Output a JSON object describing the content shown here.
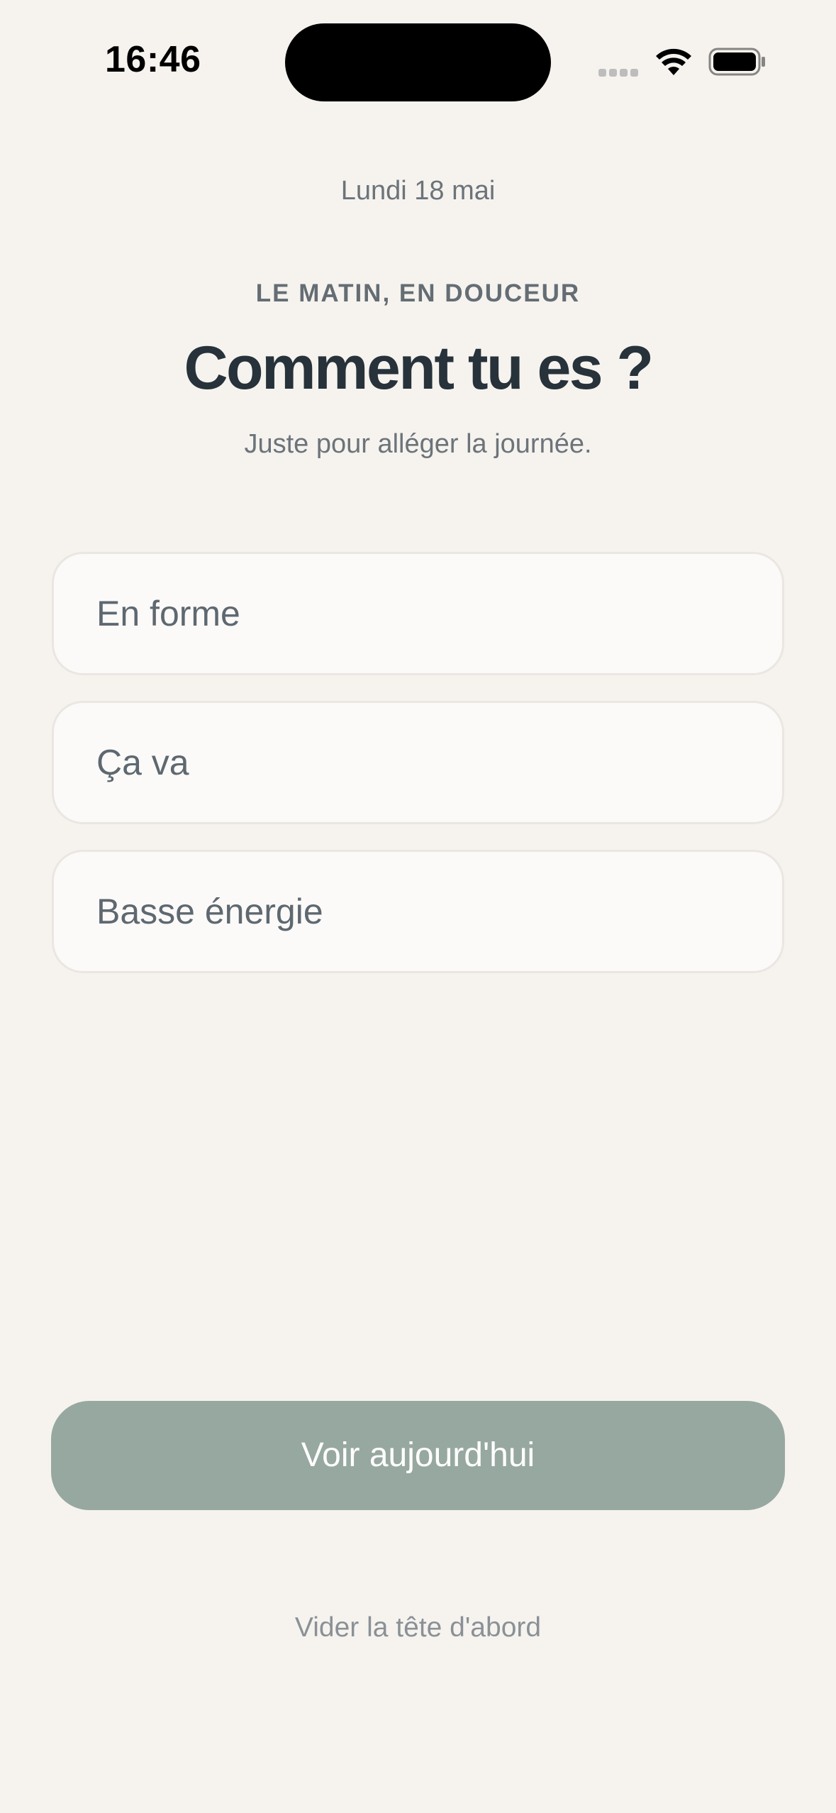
{
  "status_bar": {
    "time": "16:46",
    "icons": [
      "signal-icon",
      "wifi-icon",
      "battery-icon"
    ]
  },
  "header": {
    "date": "Lundi 18 mai",
    "eyebrow": "LE MATIN, EN DOUCEUR",
    "title": "Comment tu es ?",
    "subtitle": "Juste pour alléger la journée."
  },
  "options": [
    {
      "label": "En forme"
    },
    {
      "label": "Ça va"
    },
    {
      "label": "Basse énergie"
    }
  ],
  "actions": {
    "primary_label": "Voir aujourd'hui",
    "secondary_label": "Vider la tête d'abord"
  },
  "colors": {
    "background": "#F6F3EF",
    "primary_button": "#97A8A0",
    "title_text": "#27323A",
    "option_background": "#FBFAF8"
  }
}
